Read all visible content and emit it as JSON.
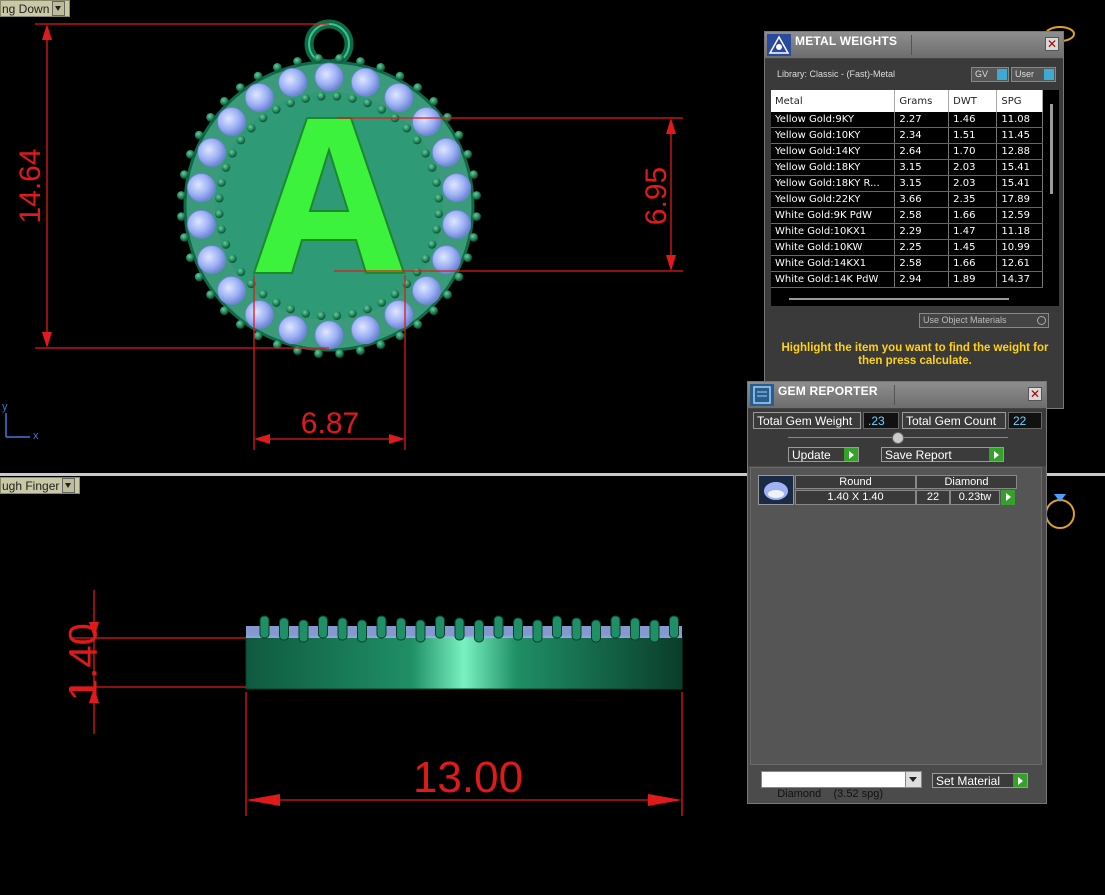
{
  "viewport_top": {
    "label": "ng Down"
  },
  "viewport_bottom": {
    "label": "ugh Finger"
  },
  "axes": {
    "y": "y",
    "x": "x"
  },
  "dimensions": {
    "pendant_height": "14.64",
    "letter_height": "6.95",
    "letter_width": "6.87",
    "thickness": "1.40",
    "diameter": "13.00"
  },
  "letter": "A",
  "metal_weights": {
    "title": "METAL WEIGHTS",
    "library": "Library: Classic - (Fast)-Metal",
    "toggle_gv": "GV",
    "toggle_user": "User",
    "columns": [
      "Metal",
      "Grams",
      "DWT",
      "SPG"
    ],
    "rows": [
      [
        "Yellow Gold:9KY",
        "2.27",
        "1.46",
        "11.08"
      ],
      [
        "Yellow Gold:10KY",
        "2.34",
        "1.51",
        "11.45"
      ],
      [
        "Yellow Gold:14KY",
        "2.64",
        "1.70",
        "12.88"
      ],
      [
        "Yellow Gold:18KY",
        "3.15",
        "2.03",
        "15.41"
      ],
      [
        "Yellow Gold:18KY R...",
        "3.15",
        "2.03",
        "15.41"
      ],
      [
        "Yellow Gold:22KY",
        "3.66",
        "2.35",
        "17.89"
      ],
      [
        "White Gold:9K PdW",
        "2.58",
        "1.66",
        "12.59"
      ],
      [
        "White Gold:10KX1",
        "2.29",
        "1.47",
        "11.18"
      ],
      [
        "White Gold:10KW",
        "2.25",
        "1.45",
        "10.99"
      ],
      [
        "White Gold:14KX1",
        "2.58",
        "1.66",
        "12.61"
      ],
      [
        "White Gold:14K PdW",
        "2.94",
        "1.89",
        "14.37"
      ]
    ],
    "use_object_materials": "Use Object Materials",
    "instruction": "Highlight the item you want to find the weight for then press calculate."
  },
  "gem_reporter": {
    "title": "GEM REPORTER",
    "total_weight_label": "Total Gem Weight",
    "total_weight_value": ".23",
    "total_count_label": "Total Gem Count",
    "total_count_value": "22",
    "update_label": "Update",
    "save_report_label": "Save Report",
    "gem": {
      "shape": "Round",
      "material": "Diamond",
      "size": "1.40 X 1.40",
      "count": "22",
      "weight": "0.23tw"
    },
    "material_select": "Diamond    (3.52 spg)",
    "set_material_label": "Set Material"
  },
  "colors": {
    "dimension_red": "#e01a1a",
    "metal_green": "#1f8f66",
    "letter_green": "#3df23d",
    "gem_blue": "#9fb3f5",
    "accent_yellow": "#ffd21a",
    "button_green": "#35a02a"
  }
}
